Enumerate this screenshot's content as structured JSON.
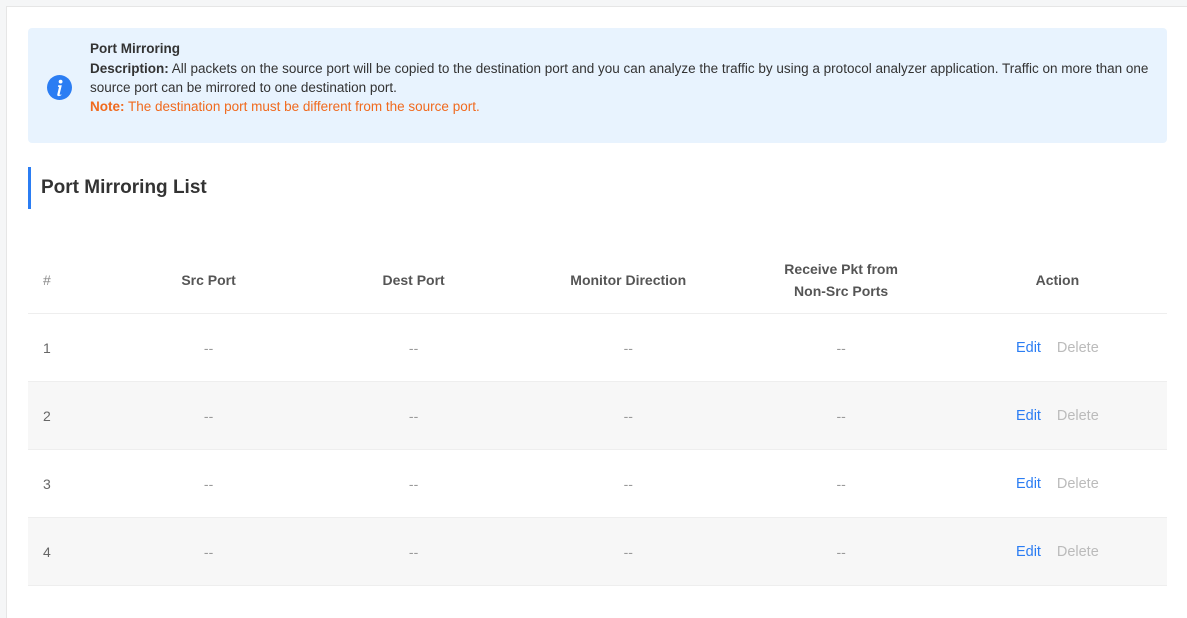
{
  "notice": {
    "title": "Port Mirroring",
    "description_label": "Description:",
    "description_text": "All packets on the source port will be copied to the destination port and you can analyze the traffic by using a protocol analyzer application. Traffic on more than one source port can be mirrored to one destination port.",
    "note_label": "Note:",
    "note_text": "The destination port must be different from the source port.",
    "icon": "info-icon",
    "icon_color": "#2b7df3",
    "note_color": "#f06a1e"
  },
  "section": {
    "title": "Port Mirroring List"
  },
  "table": {
    "headers": {
      "index": "#",
      "src_port": "Src Port",
      "dest_port": "Dest Port",
      "monitor_direction": "Monitor Direction",
      "receive_pkt_line1": "Receive Pkt from",
      "receive_pkt_line2": "Non-Src Ports",
      "action": "Action"
    },
    "rows": [
      {
        "index": "1",
        "src_port": "--",
        "dest_port": "--",
        "monitor_direction": "--",
        "receive_pkt": "--",
        "edit": "Edit",
        "delete": "Delete"
      },
      {
        "index": "2",
        "src_port": "--",
        "dest_port": "--",
        "monitor_direction": "--",
        "receive_pkt": "--",
        "edit": "Edit",
        "delete": "Delete"
      },
      {
        "index": "3",
        "src_port": "--",
        "dest_port": "--",
        "monitor_direction": "--",
        "receive_pkt": "--",
        "edit": "Edit",
        "delete": "Delete"
      },
      {
        "index": "4",
        "src_port": "--",
        "dest_port": "--",
        "monitor_direction": "--",
        "receive_pkt": "--",
        "edit": "Edit",
        "delete": "Delete"
      }
    ]
  },
  "colors": {
    "accent": "#2b7df3",
    "disabled_link": "#bbbbbb"
  }
}
